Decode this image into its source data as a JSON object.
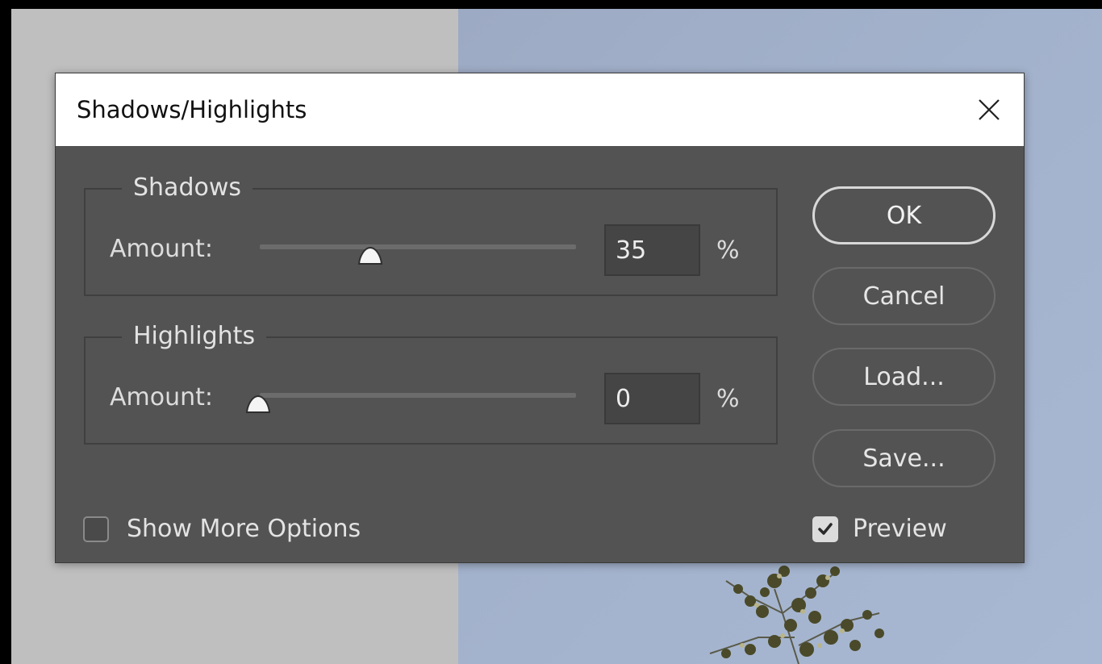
{
  "dialog": {
    "title": "Shadows/Highlights",
    "close_icon": "close-icon"
  },
  "shadows": {
    "group_title": "Shadows",
    "amount_label": "Amount:",
    "amount_value": "35",
    "amount_percent": 35,
    "unit": "%"
  },
  "highlights": {
    "group_title": "Highlights",
    "amount_label": "Amount:",
    "amount_value": "0",
    "amount_percent": 0,
    "unit": "%"
  },
  "buttons": {
    "ok": "OK",
    "cancel": "Cancel",
    "load": "Load...",
    "save": "Save..."
  },
  "options": {
    "show_more_label": "Show More Options",
    "show_more_checked": false,
    "preview_label": "Preview",
    "preview_checked": true
  },
  "colors": {
    "dialog_bg": "#535353",
    "titlebar_bg": "#ffffff",
    "workspace_gray": "#bfbfbf",
    "sky": "#a3b2cc"
  }
}
